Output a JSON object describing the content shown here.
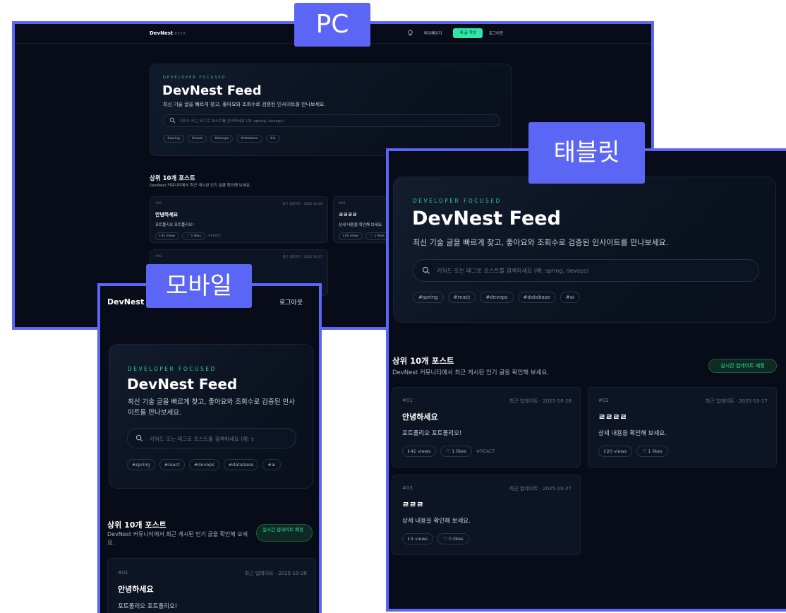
{
  "labels": {
    "pc": "PC",
    "mobile": "모바일",
    "tablet": "태블릿"
  },
  "brand": {
    "name": "DevNest",
    "beta": "BETA"
  },
  "nav": {
    "mypage": "마이페이지",
    "write": "새 글 작성",
    "logout": "로그아웃"
  },
  "hero": {
    "eyebrow": "DEVELOPER FOCUSED",
    "title": "DevNest Feed",
    "subtitle": "최신 기술 글을 빠르게 찾고, 좋아요와 조회수로 검증된 인사이트를 만나보세요.",
    "search_placeholder": "키워드 또는 태그로 포스트를 검색하세요 (예: spring, devops)",
    "mobile_search_placeholder": "키워드 또는 태그로 포스트를 검색하세요 (예: s",
    "chips": [
      "#spring",
      "#react",
      "#devops",
      "#database",
      "#ai"
    ]
  },
  "section": {
    "title": "상위 10개 포스트",
    "subtitle": "DevNest 커뮤니티에서 최근 게시된 인기 글을 확인해 보세요.",
    "badge": "실시간 업데이트 예정"
  },
  "posts": [
    {
      "num": "#01",
      "date": "최근 업데이트 · 2025-10-28",
      "title": "안녕하세요",
      "desc": "포트폴리오 포트폴리오!",
      "views": "41 views",
      "likes": "1 likes",
      "tag": "#REACT"
    },
    {
      "num": "#02",
      "date": "최근 업데이트 · 2025-10-27",
      "title": "ㄹㄹㄹㄹ",
      "desc": "상세 내용을 확인해 보세요.",
      "views": "20 views",
      "likes": "1 likes"
    },
    {
      "num": "#03",
      "date": "최근 업데이트 · 2025-10-27",
      "title": "ㄹㄹㄹ",
      "desc": "상세 내용을 확인해 보세요.",
      "views": "4 views",
      "likes": "0 likes"
    }
  ],
  "colors": {
    "frame_border": "#5b66f5",
    "accent": "#2ee6a6",
    "background": "#070c18"
  }
}
